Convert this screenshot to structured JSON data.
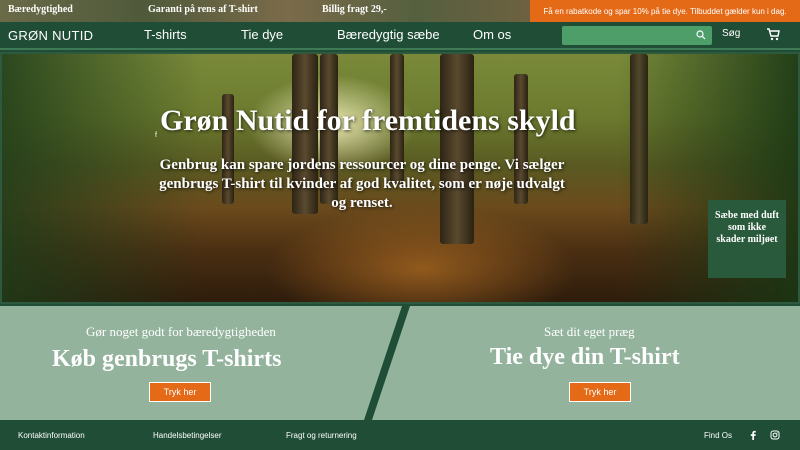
{
  "topbar": {
    "messages": [
      "Bæredygtighed",
      "Garanti på rens af T-shirt",
      "Billig fragt 29,-"
    ],
    "promo": "Få en rabatkode og spar 10% på tie dye. Tilbuddet gælder kun i dag."
  },
  "header": {
    "brand": "GRØN NUTID",
    "nav": [
      "T-shirts",
      "Tie dye",
      "Bæredygtig sæbe",
      "Om os"
    ],
    "search": {
      "value": "",
      "placeholder": ""
    },
    "search_label": "Søg"
  },
  "hero": {
    "title": "Grøn Nutid for fremtidens skyld",
    "subtitle": "Genbrug kan spare jordens ressourcer og dine penge. Vi sælger genbrugs T-shirt til kvinder af god kvalitet, som er  nøje udvalgt og renset.",
    "small_mark": "f",
    "side_box": "Sæbe med duft som ikke skader miljøet"
  },
  "panels": {
    "left": {
      "subtitle": "Gør noget godt for bæredygtigheden",
      "title": "Køb genbrugs T-shirts",
      "button": "Tryk her"
    },
    "right": {
      "subtitle": "Sæt dit eget præg",
      "title": "Tie dye din T-shirt",
      "button": "Tryk her"
    }
  },
  "footer": {
    "links": [
      "Kontaktinformation",
      "Handelsbetingelser",
      "Fragt og returnering"
    ],
    "find_us": "Find Os",
    "social_icons": [
      "facebook-icon",
      "instagram-icon"
    ]
  },
  "colors": {
    "brand_green": "#1f4d36",
    "panel_green": "#93b39d",
    "accent_orange": "#e56a17",
    "search_green": "#4e9e6a"
  }
}
